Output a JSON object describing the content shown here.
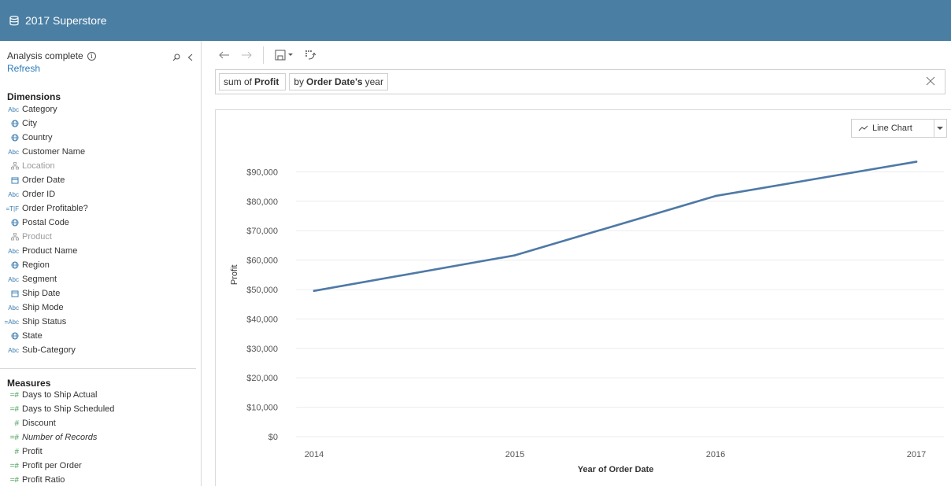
{
  "app": {
    "title": "2017 Superstore"
  },
  "sidebar": {
    "status": "Analysis complete",
    "refresh": "Refresh",
    "dimensions_title": "Dimensions",
    "dimensions": [
      {
        "type": "Abc",
        "label": "Category",
        "dim": false
      },
      {
        "type": "geo",
        "label": "City",
        "dim": false
      },
      {
        "type": "geo",
        "label": "Country",
        "dim": false
      },
      {
        "type": "Abc",
        "label": "Customer Name",
        "dim": false
      },
      {
        "type": "hier",
        "label": "Location",
        "dim": true
      },
      {
        "type": "date",
        "label": "Order Date",
        "dim": false
      },
      {
        "type": "Abc",
        "label": "Order ID",
        "dim": false
      },
      {
        "type": "=T|F",
        "label": "Order Profitable?",
        "dim": false
      },
      {
        "type": "geo",
        "label": "Postal Code",
        "dim": false
      },
      {
        "type": "hier",
        "label": "Product",
        "dim": true
      },
      {
        "type": "Abc",
        "label": "Product Name",
        "dim": false
      },
      {
        "type": "geo",
        "label": "Region",
        "dim": false
      },
      {
        "type": "Abc",
        "label": "Segment",
        "dim": false
      },
      {
        "type": "date",
        "label": "Ship Date",
        "dim": false
      },
      {
        "type": "Abc",
        "label": "Ship Mode",
        "dim": false
      },
      {
        "type": "=Abc",
        "label": "Ship Status",
        "dim": false
      },
      {
        "type": "geo",
        "label": "State",
        "dim": false
      },
      {
        "type": "Abc",
        "label": "Sub-Category",
        "dim": false
      }
    ],
    "measures_title": "Measures",
    "measures": [
      {
        "type": "=#",
        "label": "Days to Ship Actual",
        "italic": false
      },
      {
        "type": "=#",
        "label": "Days to Ship Scheduled",
        "italic": false
      },
      {
        "type": "#",
        "label": "Discount",
        "italic": false
      },
      {
        "type": "=#",
        "label": "Number of Records",
        "italic": true
      },
      {
        "type": "#",
        "label": "Profit",
        "italic": false
      },
      {
        "type": "=#",
        "label": "Profit per Order",
        "italic": false
      },
      {
        "type": "=#",
        "label": "Profit Ratio",
        "italic": false
      }
    ]
  },
  "query": {
    "pill1": {
      "prefix": "sum of",
      "field": "Profit"
    },
    "pill2": {
      "prefix": "by",
      "field": "Order Date's",
      "suffix": "year"
    }
  },
  "chart_type_select": "Line Chart",
  "colors": {
    "header": "#4a7ea3",
    "line": "#4e79a7",
    "link": "#2b7bb9"
  },
  "chart_data": {
    "type": "line",
    "x": [
      "2014",
      "2015",
      "2016",
      "2017"
    ],
    "series": [
      {
        "values": [
          49544,
          61619,
          81795,
          93439
        ]
      }
    ],
    "xlabel": "Year of Order Date",
    "ylabel": "Profit",
    "ylim": [
      0,
      100000
    ],
    "yticks": [
      0,
      10000,
      20000,
      30000,
      40000,
      50000,
      60000,
      70000,
      80000,
      90000
    ],
    "ytick_labels": [
      "$0",
      "$10,000",
      "$20,000",
      "$30,000",
      "$40,000",
      "$50,000",
      "$60,000",
      "$70,000",
      "$80,000",
      "$90,000"
    ],
    "grid": true
  }
}
